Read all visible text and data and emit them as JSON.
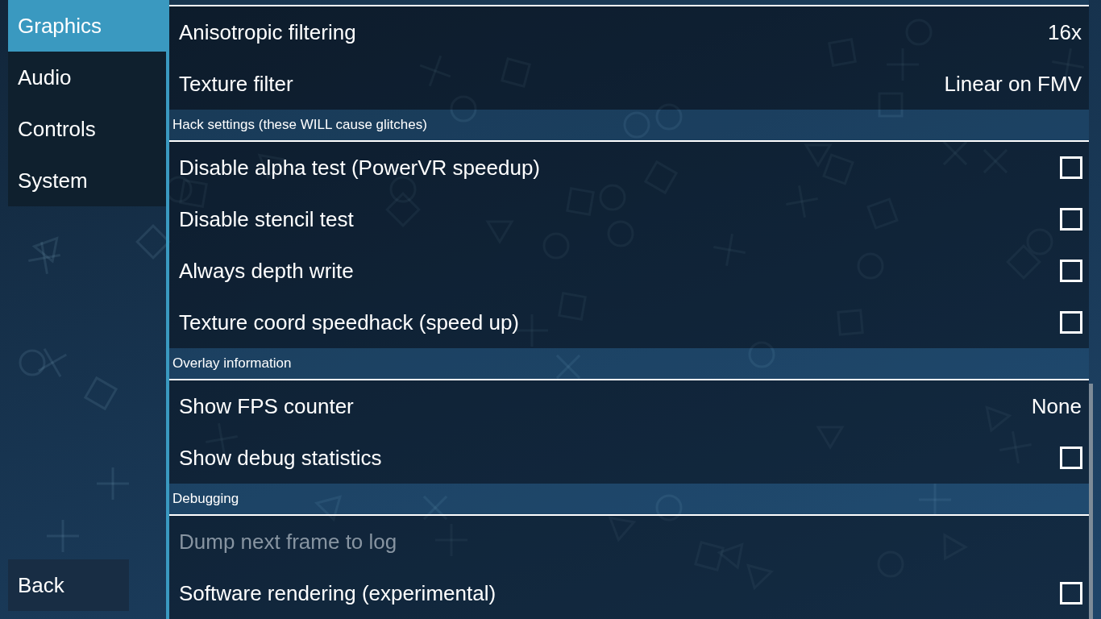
{
  "sidebar": {
    "tabs": [
      {
        "label": "Graphics",
        "selected": true
      },
      {
        "label": "Audio",
        "selected": false
      },
      {
        "label": "Controls",
        "selected": false
      },
      {
        "label": "System",
        "selected": false
      }
    ],
    "back_button": "Back"
  },
  "settings": {
    "sections": [
      {
        "items": [
          {
            "kind": "choice",
            "label": "Anisotropic filtering",
            "value": "16x",
            "disabled": false
          },
          {
            "kind": "choice",
            "label": "Texture filter",
            "value": "Linear on FMV",
            "disabled": false
          }
        ]
      },
      {
        "header": "Hack settings (these WILL cause glitches)",
        "items": [
          {
            "kind": "checkbox",
            "label": "Disable alpha test (PowerVR speedup)",
            "checked": false,
            "disabled": false
          },
          {
            "kind": "checkbox",
            "label": "Disable stencil test",
            "checked": false,
            "disabled": false
          },
          {
            "kind": "checkbox",
            "label": "Always depth write",
            "checked": false,
            "disabled": false
          },
          {
            "kind": "checkbox",
            "label": "Texture coord speedhack (speed up)",
            "checked": false,
            "disabled": false
          }
        ]
      },
      {
        "header": "Overlay information",
        "items": [
          {
            "kind": "choice",
            "label": "Show FPS counter",
            "value": "None",
            "disabled": false
          },
          {
            "kind": "checkbox",
            "label": "Show debug statistics",
            "checked": false,
            "disabled": false
          }
        ]
      },
      {
        "header": "Debugging",
        "items": [
          {
            "kind": "action",
            "label": "Dump next frame to log",
            "disabled": true
          },
          {
            "kind": "checkbox",
            "label": "Software rendering (experimental)",
            "checked": false,
            "disabled": false
          }
        ]
      }
    ]
  }
}
